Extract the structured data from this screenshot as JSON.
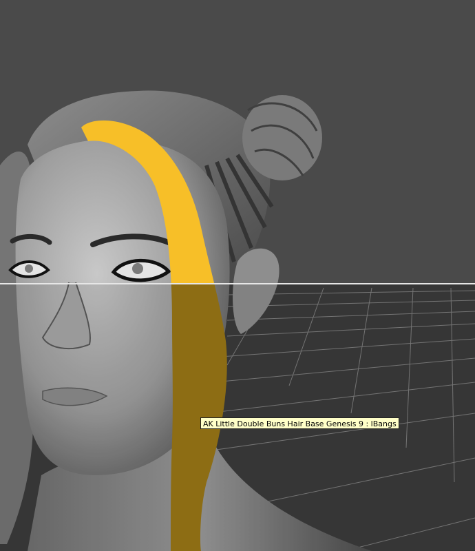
{
  "viewport": {
    "background_color": "#4a4a4a",
    "floor_color": "#3b3b3b",
    "grid_line_color": "#8a8a8a",
    "horizon_line_color": "#e6e6e6",
    "selection_highlight_color": "#f7bf28",
    "selection_highlight_dim_color": "#9a7716",
    "figure_skin_color": "#9c9c9c",
    "figure_hair_color": "#6e6e6e"
  },
  "tooltip": {
    "text": "AK Little Double Buns Hair Base Genesis 9 : lBangs"
  }
}
